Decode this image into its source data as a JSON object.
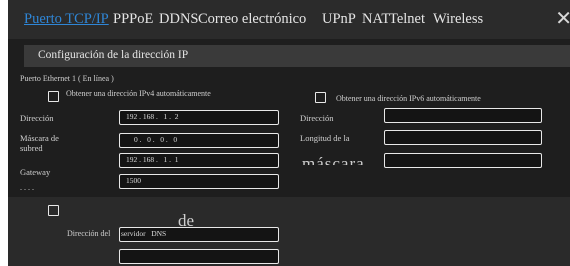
{
  "tabs": [
    {
      "label": "Puerto TCP/IP",
      "active": true
    },
    {
      "label": "PPPoE",
      "active": false
    },
    {
      "label": "DDNS",
      "active": false
    },
    {
      "label": "Correo electrónico",
      "active": false
    },
    {
      "label": "UPnP",
      "active": false
    },
    {
      "label": "NAT",
      "active": false
    },
    {
      "label": "Telnet",
      "active": false
    },
    {
      "label": "Wireless",
      "active": false
    }
  ],
  "close_icon": "close-icon",
  "section_title": "Configuración de la dirección IP",
  "port_label": "Puerto Ethernet 1 ( En línea )",
  "ipv4": {
    "auto_label": "Obtener una dirección IPv4 automáticamente",
    "address_label": "Dirección",
    "address_value": "192 . 168 .   1 .  2",
    "mask_label_line1": "Máscara de",
    "mask_label_line2": "subred",
    "mask_value": "0 .   0 .   0 .   0",
    "gateway_label": "Gateway",
    "gateway_value": "192 . 168 .   1 .  1",
    "mtu_value": "1500"
  },
  "ipv6": {
    "auto_label": "Obtener una dirección IPv6 automáticamente",
    "address_label": "Dirección",
    "prefix_label": "Longitud de la",
    "prefix_overflow": "máscara"
  },
  "dns": {
    "label_part1": "Dirección del",
    "label_part2": "servidor   DNS",
    "overflow_text": "de"
  }
}
